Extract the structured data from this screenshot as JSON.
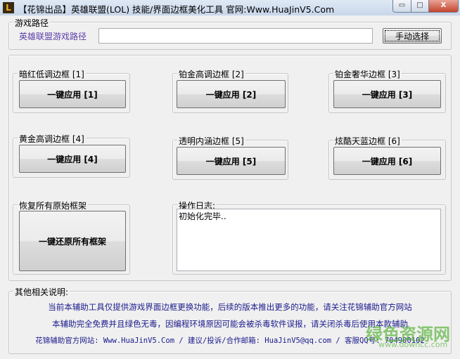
{
  "window": {
    "title": "【花锦出品】英雄联盟(LOL) 技能/界面边框美化工具 官网:Www.HuaJinV5.Com",
    "icon": "L",
    "minimize": "▭",
    "maximize": "□",
    "close": "X"
  },
  "path": {
    "legend": "游戏路径",
    "label": "英雄联盟游戏路径",
    "value": "",
    "browse": "手动选择"
  },
  "frames": [
    {
      "legend": "暗红低调边框 [1]",
      "button": "一键应用 [1]"
    },
    {
      "legend": "铂金高调边框 [2]",
      "button": "一键应用 [2]"
    },
    {
      "legend": "铂金奢华边框 [3]",
      "button": "一键应用 [3]"
    },
    {
      "legend": "黄金高调边框 [4]",
      "button": "一键应用 [4]"
    },
    {
      "legend": "透明内涵边框 [5]",
      "button": "一键应用 [5]"
    },
    {
      "legend": "炫酷天蓝边框 [6]",
      "button": "一键应用 [6]"
    }
  ],
  "restore": {
    "legend": "恢复所有原始框架",
    "button": "一键还原所有框架"
  },
  "log": {
    "legend": "操作日志:",
    "text": "初始化完毕.."
  },
  "notes": {
    "legend": "其他相关说明:",
    "lines": [
      "当前本辅助工具仅提供游戏界面边框更换功能，后续的版本推出更多的功能，请关注花锦辅助官方网站",
      "本辅助完全免费并且绿色无毒，因编程环境原因可能会被杀毒软件误报，请关闭杀毒后使用本款辅助",
      "花锦辅助官方网站: Www.HuaJinV5.Com / 建议/投诉/合作邮箱: HuaJinV5@qq.com / 客服QQ号: 704900102"
    ]
  },
  "watermark": {
    "title": "绿色资源网",
    "url": "www.downcc.com"
  }
}
